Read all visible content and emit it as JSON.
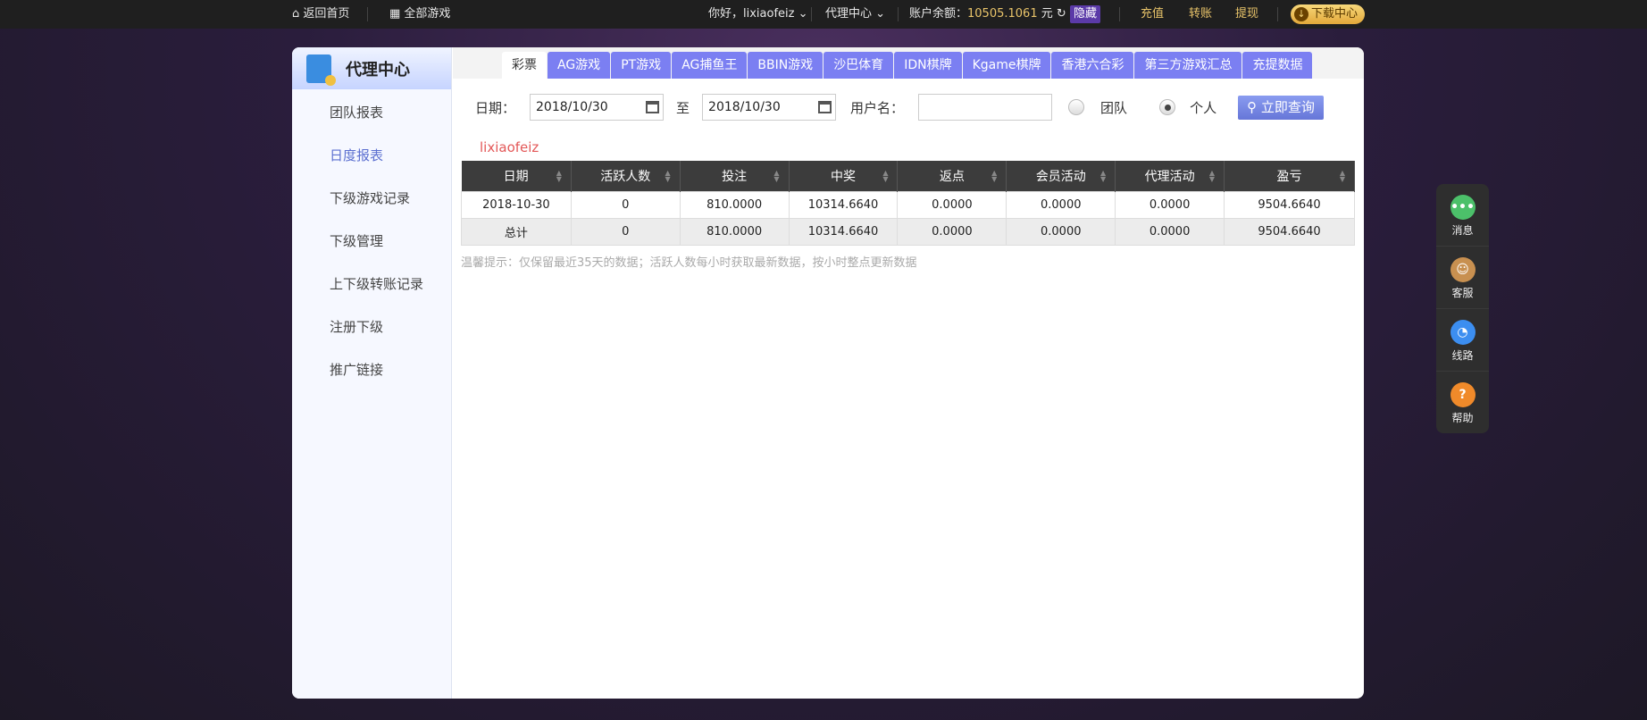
{
  "topbar": {
    "home": "返回首页",
    "all_games": "全部游戏",
    "greeting": "你好，lixiaofeiz",
    "agent_center": "代理中心",
    "balance_label": "账户余额：",
    "balance": "10505.1061",
    "currency": "元",
    "hide": "隐藏",
    "recharge": "充值",
    "transfer": "转账",
    "withdraw": "提现",
    "download": "下载中心"
  },
  "sidebar": {
    "title": "代理中心",
    "items": [
      {
        "label": "团队报表"
      },
      {
        "label": "日度报表"
      },
      {
        "label": "下级游戏记录"
      },
      {
        "label": "下级管理"
      },
      {
        "label": "上下级转账记录"
      },
      {
        "label": "注册下级"
      },
      {
        "label": "推广链接"
      }
    ]
  },
  "tabs": [
    "彩票",
    "AG游戏",
    "PT游戏",
    "AG捕鱼王",
    "BBIN游戏",
    "沙巴体育",
    "IDN棋牌",
    "Kgame棋牌",
    "香港六合彩",
    "第三方游戏汇总",
    "充提数据"
  ],
  "form": {
    "date_label": "日期：",
    "date_from": "2018/10/30",
    "to_label": "至",
    "date_to": "2018/10/30",
    "username_label": "用户名：",
    "username_value": "",
    "team": "团队",
    "personal": "个人",
    "query": "立即查询"
  },
  "username": "lixiaofeiz",
  "table": {
    "headers": [
      "日期",
      "活跃人数",
      "投注",
      "中奖",
      "返点",
      "会员活动",
      "代理活动",
      "盈亏"
    ],
    "rows": [
      [
        "2018-10-30",
        "0",
        "810.0000",
        "10314.6640",
        "0.0000",
        "0.0000",
        "0.0000",
        "9504.6640"
      ],
      [
        "总计",
        "0",
        "810.0000",
        "10314.6640",
        "0.0000",
        "0.0000",
        "0.0000",
        "9504.6640"
      ]
    ]
  },
  "tip": "温馨提示：仅保留最近35天的数据；活跃人数每小时获取最新数据，按小时整点更新数据",
  "float": [
    {
      "label": "消息",
      "icon": "chat-icon",
      "color": "#4cc06a"
    },
    {
      "label": "客服",
      "icon": "support-icon",
      "color": "#c89050"
    },
    {
      "label": "线路",
      "icon": "gauge-icon",
      "color": "#3c8ef0"
    },
    {
      "label": "帮助",
      "icon": "help-icon",
      "color": "#f08a2a"
    }
  ]
}
